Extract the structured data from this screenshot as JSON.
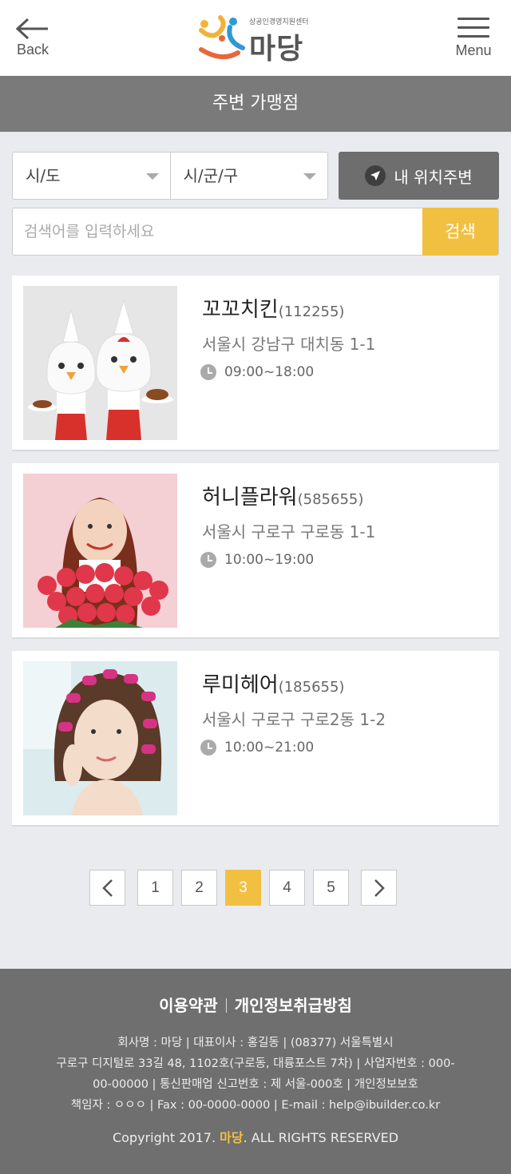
{
  "header": {
    "back_label": "Back",
    "menu_label": "Menu",
    "logo_subtitle": "상공인경영지원센터",
    "logo_title": "마당"
  },
  "page_title": "주변 가맹점",
  "filters": {
    "province": "시/도",
    "district": "시/군/구",
    "location_button": "내 위치주변"
  },
  "search": {
    "placeholder": "검색어를 입력하세요",
    "button": "검색"
  },
  "stores": [
    {
      "name": "꼬꼬치킨",
      "code": "(112255)",
      "address": "서울시 강남구 대치동 1-1",
      "hours": "09:00~18:00"
    },
    {
      "name": "허니플라워",
      "code": "(585655)",
      "address": "서울시 구로구 구로동 1-1",
      "hours": "10:00~19:00"
    },
    {
      "name": "루미헤어",
      "code": "(185655)",
      "address": "서울시 구로구 구로2동 1-2",
      "hours": "10:00~21:00"
    }
  ],
  "pagination": {
    "prev": "‹",
    "pages": [
      "1",
      "2",
      "3",
      "4",
      "5"
    ],
    "current": "3",
    "next": "›"
  },
  "footer": {
    "terms": "이용약관",
    "privacy": "개인정보취급방침",
    "info_line1": "회사명 : 마당  |  대표이사 : 홍길동  |  (08377) 서울특별시",
    "info_line2": "구로구 디지털로 33길 48, 1102호(구로동, 대륭포스트 7차)  |  사업자번호 : 000-",
    "info_line3": "00-00000  |  통신판매업 신고번호 : 제 서울-000호  |  개인정보보호",
    "info_line4": "책임자 : ㅇㅇㅇ  |  Fax : 00-0000-0000  |  E-mail : help@ibuilder.co.kr",
    "copyright_prefix": "Copyright 2017.",
    "copyright_brand": "마당",
    "copyright_suffix": ". ALL RIGHTS RESERVED"
  },
  "colors": {
    "accent": "#f2c041",
    "titlebar": "#7a7a7a",
    "footer": "#6f6f6f",
    "background": "#e9ebef"
  }
}
